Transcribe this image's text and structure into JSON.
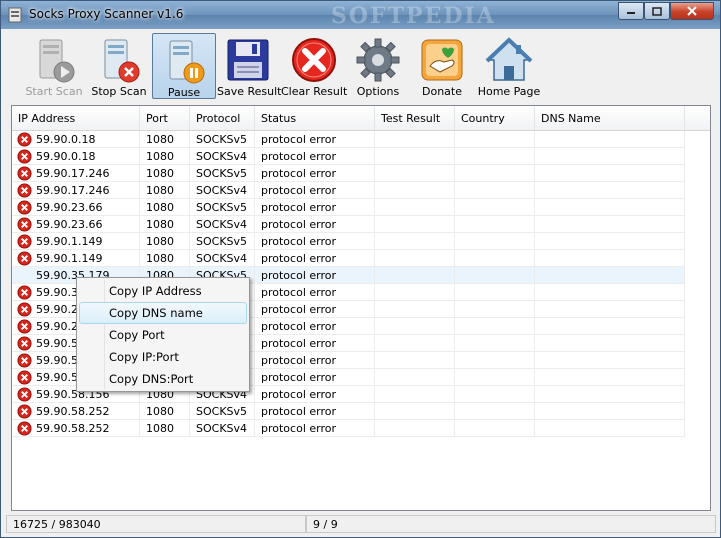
{
  "window": {
    "title": "Socks Proxy Scanner v1.6",
    "watermark": "SOFTPEDIA"
  },
  "toolbar": {
    "buttons": [
      {
        "label": "Start Scan",
        "icon": "server-play-icon",
        "disabled": true
      },
      {
        "label": "Stop Scan",
        "icon": "server-stop-icon",
        "disabled": false
      },
      {
        "label": "Pause",
        "icon": "server-pause-icon",
        "disabled": false,
        "pressed": true
      },
      {
        "label": "Save Result",
        "icon": "floppy-disk-icon",
        "disabled": false
      },
      {
        "label": "Clear Result",
        "icon": "red-x-icon",
        "disabled": false
      },
      {
        "label": "Options",
        "icon": "gear-icon",
        "disabled": false
      },
      {
        "label": "Donate",
        "icon": "donate-hand-icon",
        "disabled": false
      },
      {
        "label": "Home Page",
        "icon": "house-icon",
        "disabled": false
      }
    ]
  },
  "table": {
    "columns": [
      "IP Address",
      "Port",
      "Protocol",
      "Status",
      "Test Result",
      "Country",
      "DNS Name"
    ],
    "rows": [
      {
        "ip": "59.90.0.18",
        "port": "1080",
        "protocol": "SOCKSv5",
        "status": "protocol error"
      },
      {
        "ip": "59.90.0.18",
        "port": "1080",
        "protocol": "SOCKSv4",
        "status": "protocol error"
      },
      {
        "ip": "59.90.17.246",
        "port": "1080",
        "protocol": "SOCKSv5",
        "status": "protocol error"
      },
      {
        "ip": "59.90.17.246",
        "port": "1080",
        "protocol": "SOCKSv4",
        "status": "protocol error"
      },
      {
        "ip": "59.90.23.66",
        "port": "1080",
        "protocol": "SOCKSv5",
        "status": "protocol error"
      },
      {
        "ip": "59.90.23.66",
        "port": "1080",
        "protocol": "SOCKSv4",
        "status": "protocol error"
      },
      {
        "ip": "59.90.1.149",
        "port": "1080",
        "protocol": "SOCKSv5",
        "status": "protocol error"
      },
      {
        "ip": "59.90.1.149",
        "port": "1080",
        "protocol": "SOCKSv4",
        "status": "protocol error"
      },
      {
        "ip": "59.90.35.179",
        "port": "1080",
        "protocol": "SOCKSv5",
        "status": "protocol error",
        "selected": true
      },
      {
        "ip": "59.90.3",
        "port": "",
        "protocol": "",
        "status": "protocol error"
      },
      {
        "ip": "59.90.2",
        "port": "",
        "protocol": "",
        "status": "protocol error"
      },
      {
        "ip": "59.90.2",
        "port": "",
        "protocol": "",
        "status": "protocol error"
      },
      {
        "ip": "59.90.5",
        "port": "",
        "protocol": "",
        "status": "protocol error"
      },
      {
        "ip": "59.90.5",
        "port": "",
        "protocol": "",
        "status": "protocol error"
      },
      {
        "ip": "59.90.5",
        "port": "",
        "protocol": "",
        "status": "protocol error"
      },
      {
        "ip": "59.90.58.156",
        "port": "1080",
        "protocol": "SOCKSv4",
        "status": "protocol error"
      },
      {
        "ip": "59.90.58.252",
        "port": "1080",
        "protocol": "SOCKSv5",
        "status": "protocol error"
      },
      {
        "ip": "59.90.58.252",
        "port": "1080",
        "protocol": "SOCKSv4",
        "status": "protocol error"
      }
    ]
  },
  "context_menu": {
    "items": [
      "Copy IP Address",
      "Copy DNS name",
      "Copy Port",
      "Copy IP:Port",
      "Copy DNS:Port"
    ],
    "hovered_index": 1
  },
  "statusbar": {
    "progress": "16725 / 983040",
    "threads": "9 / 9"
  },
  "colors": {
    "error_red": "#d9261c",
    "selection": "#eaf4fd"
  }
}
